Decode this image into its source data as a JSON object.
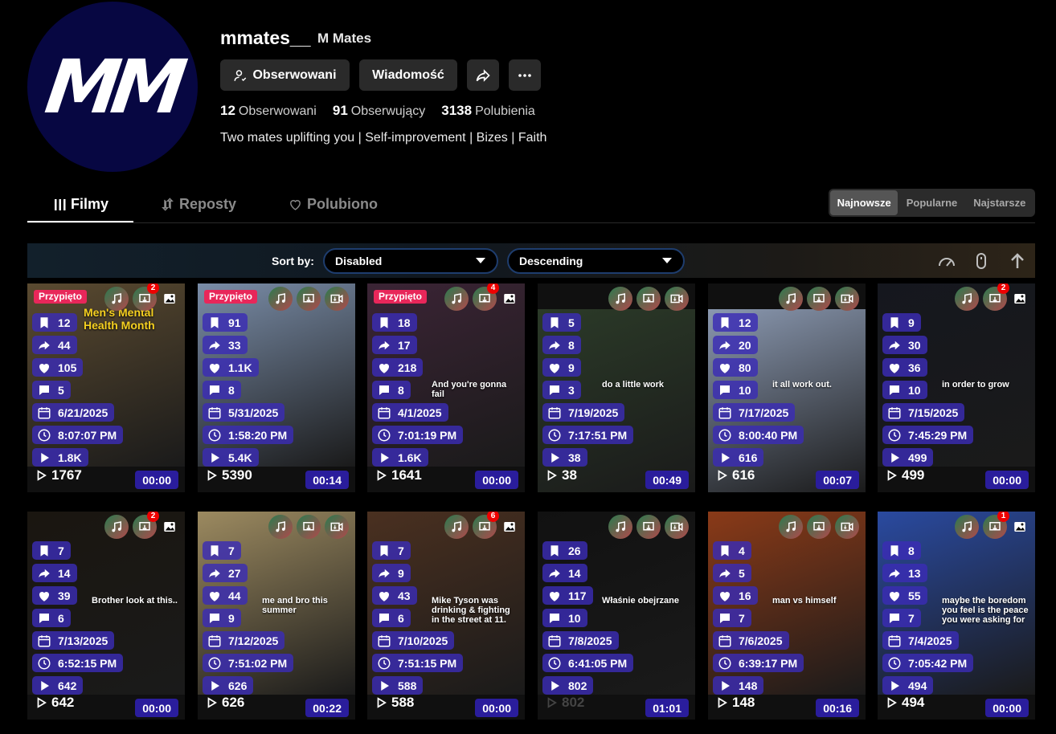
{
  "profile": {
    "avatar_initials": "MM",
    "username": "mmates__",
    "nickname": "M Mates",
    "following_button": "Obserwowani",
    "message_button": "Wiadomość",
    "following_count": "12",
    "following_label": "Obserwowani",
    "followers_count": "91",
    "followers_label": "Obserwujący",
    "likes_count": "3138",
    "likes_label": "Polubienia",
    "bio": "Two mates uplifting you | Self-improvement | Bizes | Faith"
  },
  "tabs": {
    "videos": "Filmy",
    "reposts": "Reposty",
    "liked": "Polubiono"
  },
  "order": {
    "newest": "Najnowsze",
    "popular": "Popularne",
    "oldest": "Najstarsze",
    "active": "newest"
  },
  "sortbar": {
    "label": "Sort by:",
    "sort_value": "Disabled",
    "direction_value": "Descending"
  },
  "pinned_label": "Przypięto",
  "colors": {
    "stat_bg": "#3b2cb4",
    "duration_bg": "#2a1d9c",
    "pin_bg": "#e8275a",
    "badge": "#e00000"
  },
  "videos": [
    {
      "saves": "12",
      "shares": "44",
      "likes": "105",
      "comments": "5",
      "date": "6/21/2025",
      "time": "8:07:07 PM",
      "views": "1.8K",
      "plays": "1767",
      "duration": "00:00",
      "pinned": true,
      "badge": "2",
      "thumb": "Men's Mental Health Month",
      "overlay": "",
      "bg": "#5a4a30"
    },
    {
      "saves": "91",
      "shares": "33",
      "likes": "1.1K",
      "comments": "8",
      "date": "5/31/2025",
      "time": "1:58:20 PM",
      "views": "5.4K",
      "plays": "5390",
      "duration": "00:14",
      "pinned": true,
      "badge": "",
      "overlay": "",
      "bg": "#7a8da8"
    },
    {
      "saves": "18",
      "shares": "17",
      "likes": "218",
      "comments": "8",
      "date": "4/1/2025",
      "time": "7:01:19 PM",
      "views": "1.6K",
      "plays": "1641",
      "duration": "00:00",
      "pinned": true,
      "badge": "4",
      "overlay": "And you're gonna fail",
      "bg": "#3b2435"
    },
    {
      "saves": "5",
      "shares": "8",
      "likes": "9",
      "comments": "3",
      "date": "7/19/2025",
      "time": "7:17:51 PM",
      "views": "38",
      "plays": "38",
      "duration": "00:49",
      "pinned": false,
      "badge": "",
      "overlay": "do a little work",
      "bg": "#2b3a28"
    },
    {
      "saves": "12",
      "shares": "20",
      "likes": "80",
      "comments": "10",
      "date": "7/17/2025",
      "time": "8:00:40 PM",
      "views": "616",
      "plays": "616",
      "duration": "00:07",
      "pinned": false,
      "badge": "",
      "overlay": "it all work out.",
      "bg": "#8a98b0"
    },
    {
      "saves": "9",
      "shares": "30",
      "likes": "36",
      "comments": "10",
      "date": "7/15/2025",
      "time": "7:45:29 PM",
      "views": "499",
      "plays": "499",
      "duration": "00:00",
      "pinned": false,
      "badge": "2",
      "overlay": "in order to grow",
      "bg": "#15171e"
    },
    {
      "saves": "7",
      "shares": "14",
      "likes": "39",
      "comments": "6",
      "date": "7/13/2025",
      "time": "6:52:15 PM",
      "views": "642",
      "plays": "642",
      "duration": "00:00",
      "pinned": false,
      "badge": "2",
      "overlay": "Brother look at this..",
      "bg": "#1a1610"
    },
    {
      "saves": "7",
      "shares": "27",
      "likes": "44",
      "comments": "9",
      "date": "7/12/2025",
      "time": "7:51:02 PM",
      "views": "626",
      "plays": "626",
      "duration": "00:22",
      "pinned": false,
      "badge": "",
      "overlay": "me and bro this summer",
      "bg": "#9c8a60"
    },
    {
      "saves": "7",
      "shares": "9",
      "likes": "43",
      "comments": "6",
      "date": "7/10/2025",
      "time": "7:51:15 PM",
      "views": "588",
      "plays": "588",
      "duration": "00:00",
      "pinned": false,
      "badge": "6",
      "overlay": "Mike Tyson was drinking & fighting in the street at 11.",
      "bg": "#4a3020"
    },
    {
      "saves": "26",
      "shares": "14",
      "likes": "117",
      "comments": "10",
      "date": "7/8/2025",
      "time": "6:41:05 PM",
      "views": "802",
      "plays": "802",
      "duration": "01:01",
      "pinned": false,
      "badge": "",
      "overlay": "Właśnie obejrzane",
      "bg": "#111111"
    },
    {
      "saves": "4",
      "shares": "5",
      "likes": "16",
      "comments": "7",
      "date": "7/6/2025",
      "time": "6:39:17 PM",
      "views": "148",
      "plays": "148",
      "duration": "00:16",
      "pinned": false,
      "badge": "",
      "overlay": "man vs himself",
      "bg": "#8a3a18"
    },
    {
      "saves": "8",
      "shares": "13",
      "likes": "55",
      "comments": "7",
      "date": "7/4/2025",
      "time": "7:05:42 PM",
      "views": "494",
      "plays": "494",
      "duration": "00:00",
      "pinned": false,
      "badge": "1",
      "overlay": "maybe the boredom you feel is the peace you were asking for",
      "bg": "#2a4aa0"
    }
  ]
}
